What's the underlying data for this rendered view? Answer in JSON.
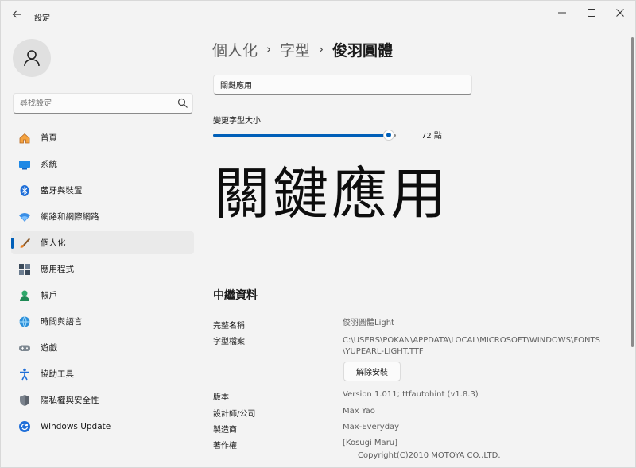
{
  "app": {
    "title": "設定",
    "back_icon": "arrow-left-icon",
    "min_icon": "minimize-icon",
    "max_icon": "maximize-icon",
    "close_icon": "close-icon"
  },
  "search": {
    "placeholder": "尋找設定",
    "value": ""
  },
  "sidebar": {
    "items": [
      {
        "label": "首頁",
        "icon": "home-icon"
      },
      {
        "label": "系統",
        "icon": "system-icon"
      },
      {
        "label": "藍牙與裝置",
        "icon": "bluetooth-icon"
      },
      {
        "label": "網路和網際網路",
        "icon": "network-icon"
      },
      {
        "label": "個人化",
        "icon": "personalization-icon",
        "active": true
      },
      {
        "label": "應用程式",
        "icon": "apps-icon"
      },
      {
        "label": "帳戶",
        "icon": "account-icon"
      },
      {
        "label": "時間與語言",
        "icon": "time-language-icon"
      },
      {
        "label": "遊戲",
        "icon": "gaming-icon"
      },
      {
        "label": "協助工具",
        "icon": "accessibility-icon"
      },
      {
        "label": "隱私權與安全性",
        "icon": "privacy-shield-icon"
      },
      {
        "label": "Windows Update",
        "icon": "windows-update-icon"
      }
    ]
  },
  "breadcrumb": {
    "level1": "個人化",
    "level2": "字型",
    "current": "俊羽圓體",
    "separator": "›"
  },
  "preview": {
    "value": "關鍵應用",
    "sample_text": "關鍵應用"
  },
  "font_size": {
    "label": "變更字型大小",
    "value_text": "72 點",
    "slider_fraction": 0.96
  },
  "metadata": {
    "title": "中繼資料",
    "full_name": {
      "key": "完整名稱",
      "value": "俊羽圓體Light"
    },
    "font_file": {
      "key": "字型檔案",
      "value_line1": "C:\\USERS\\POKAN\\APPDATA\\LOCAL\\MICROSOFT\\WINDOWS\\FONTS",
      "value_line2": "\\YUPEARL-LIGHT.TTF"
    },
    "uninstall_label": "解除安裝",
    "version": {
      "key": "版本",
      "value": "Version 1.011; ttfautohint (v1.8.3)"
    },
    "designer": {
      "key": "設計師/公司",
      "value": "Max Yao"
    },
    "manufacturer": {
      "key": "製造商",
      "value": "Max-Everyday"
    },
    "copyright": {
      "key": "著作權",
      "value_line1": "[Kosugi Maru]",
      "value_line2": "Copyright(C)2010 MOTOYA CO.,LTD."
    }
  },
  "colors": {
    "accent": "#005fb8",
    "background": "#f3f3f3"
  }
}
